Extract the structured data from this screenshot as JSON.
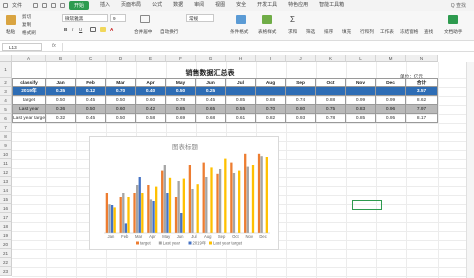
{
  "menu": {
    "file": "文件",
    "items": [
      "开始",
      "插入",
      "页面布局",
      "公式",
      "数据",
      "审阅",
      "视图",
      "安全",
      "开发工具",
      "特色应用",
      "智能工具箱"
    ],
    "active_index": 0,
    "search": "Q 查找"
  },
  "ribbon": {
    "paste": "粘贴",
    "cut": "剪切",
    "copy": "复制",
    "format_painter": "格式刷",
    "font_name": "微软雅黑",
    "font_size": "9",
    "merge_center": "合并居中",
    "wrap": "自动换行",
    "general": "常规",
    "cond_format": "条件格式",
    "table_style": "表格样式",
    "sum": "求和",
    "filter": "筛选",
    "sort": "排序",
    "fill": "填充",
    "rowcol": "行和列",
    "sheet": "工作表",
    "freeze": "冻结窗格",
    "find": "查找",
    "doc_assist": "文档助手"
  },
  "formula_bar": {
    "name_box": "L13",
    "fx": "fx",
    "value": ""
  },
  "columns": [
    "A",
    "B",
    "C",
    "D",
    "E",
    "F",
    "G",
    "H",
    "I",
    "J",
    "K",
    "L",
    "M",
    "N"
  ],
  "rows": [
    "1",
    "2",
    "3",
    "4",
    "5",
    "6",
    "7",
    "8",
    "9",
    "10",
    "11",
    "12",
    "13",
    "14",
    "15",
    "16",
    "17",
    "18",
    "19",
    "20",
    "21",
    "22",
    "23"
  ],
  "sheet": {
    "title": "销售数据汇总表",
    "unit": "单位：亿元",
    "header": [
      "classify",
      "Jan",
      "Feb",
      "Mar",
      "Apr",
      "May",
      "Jun",
      "Jul",
      "Aug",
      "Sep",
      "Oct",
      "Nov",
      "Dec",
      "合计"
    ],
    "rows": [
      [
        "2019年",
        "0.35",
        "0.12",
        "0.70",
        "0.40",
        "0.50",
        "0.25",
        "",
        "",
        "",
        "",
        "",
        "",
        "3.57"
      ],
      [
        "target",
        "0.50",
        "0.45",
        "0.50",
        "0.60",
        "0.78",
        "0.45",
        "0.85",
        "0.88",
        "0.74",
        "0.88",
        "0.99",
        "0.99",
        "8.62"
      ],
      [
        "Last year",
        "0.36",
        "0.50",
        "0.60",
        "0.42",
        "0.85",
        "0.65",
        "0.55",
        "0.70",
        "0.80",
        "0.75",
        "0.83",
        "0.96",
        "7.97"
      ],
      [
        "Last year target",
        "0.32",
        "0.45",
        "0.50",
        "0.58",
        "0.69",
        "0.68",
        "0.61",
        "0.82",
        "0.93",
        "0.78",
        "0.85",
        "0.95",
        "8.17"
      ]
    ]
  },
  "chart_data": {
    "type": "bar",
    "title": "图表标题",
    "categories": [
      "Jan",
      "Feb",
      "Mar",
      "Apr",
      "May",
      "Jun",
      "Jul",
      "Aug",
      "Sep",
      "Oct",
      "Nov",
      "Dec"
    ],
    "series": [
      {
        "name": "target",
        "color": "#ed7d31",
        "values": [
          0.5,
          0.45,
          0.5,
          0.6,
          0.78,
          0.45,
          0.85,
          0.88,
          0.74,
          0.88,
          0.99,
          0.99
        ]
      },
      {
        "name": "Last year",
        "color": "#a5a5a5",
        "values": [
          0.36,
          0.5,
          0.6,
          0.42,
          0.85,
          0.65,
          0.55,
          0.7,
          0.8,
          0.75,
          0.83,
          0.96
        ]
      },
      {
        "name": "2019年",
        "color": "#4472c4",
        "values": [
          0.35,
          0.12,
          0.7,
          0.4,
          0.5,
          0.25,
          null,
          null,
          null,
          null,
          null,
          null
        ]
      },
      {
        "name": "Last year target",
        "color": "#ffc000",
        "values": [
          0.32,
          0.45,
          0.5,
          0.58,
          0.69,
          0.68,
          0.61,
          0.82,
          0.93,
          0.78,
          0.85,
          0.95
        ]
      }
    ],
    "legend_position": "bottom",
    "grid": false
  },
  "colors": {
    "accent": "#2e9b4f",
    "header_blue": "#2e6db5",
    "row_grey": "#b9b9b9"
  }
}
